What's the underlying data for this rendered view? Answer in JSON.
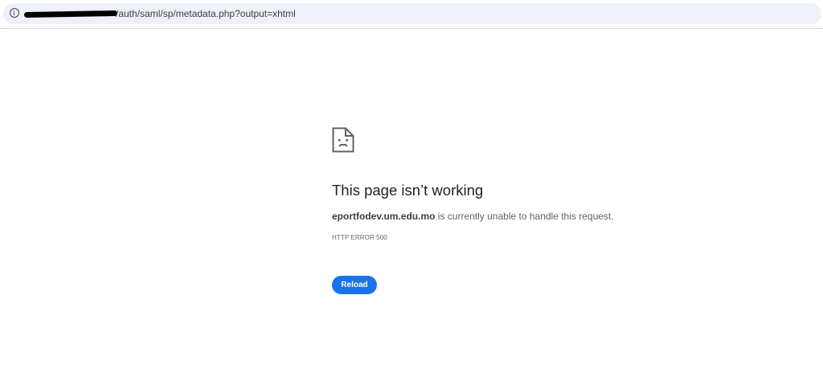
{
  "address_bar": {
    "url_visible": "/auth/saml/sp/metadata.php?output=xhtml",
    "icon": "info-icon"
  },
  "error": {
    "icon": "sad-page-icon",
    "title": "This page isn’t working",
    "host": "eportfodev.um.edu.mo",
    "message": " is currently unable to handle this request.",
    "code": "HTTP ERROR 500",
    "reload_label": "Reload"
  },
  "colors": {
    "accent": "#1a73e8",
    "address_bar_bg": "#eef1f9",
    "title": "#202124",
    "body_text": "#5f6368"
  }
}
